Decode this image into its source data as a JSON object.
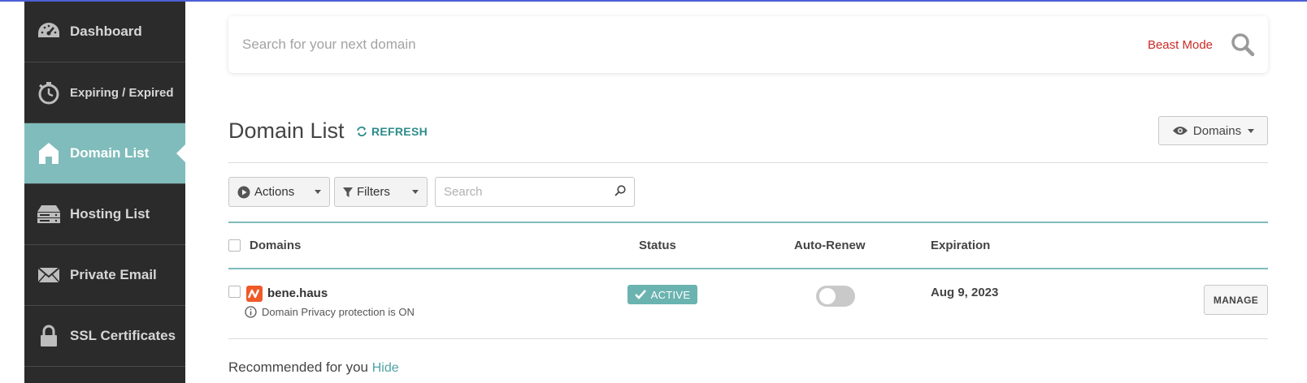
{
  "sidebar": {
    "items": [
      {
        "label": "Dashboard",
        "icon": "gauge-icon"
      },
      {
        "label": "Expiring / Expired",
        "icon": "stopwatch-icon"
      },
      {
        "label": "Domain List",
        "icon": "home-icon",
        "active": true
      },
      {
        "label": "Hosting List",
        "icon": "server-icon"
      },
      {
        "label": "Private Email",
        "icon": "envelope-icon"
      },
      {
        "label": "SSL Certificates",
        "icon": "lock-icon"
      }
    ]
  },
  "search": {
    "placeholder": "Search for your next domain",
    "beast_mode": "Beast Mode"
  },
  "header": {
    "title": "Domain List",
    "refresh": "REFRESH",
    "view_button": "Domains"
  },
  "toolbar": {
    "actions": "Actions",
    "filters": "Filters",
    "search_placeholder": "Search"
  },
  "table": {
    "columns": [
      "Domains",
      "Status",
      "Auto-Renew",
      "Expiration"
    ],
    "rows": [
      {
        "domain": "bene.haus",
        "note": "Domain Privacy protection is ON",
        "status": "ACTIVE",
        "auto_renew": false,
        "expiration": "Aug 9, 2023",
        "action": "MANAGE"
      }
    ]
  },
  "recommended": {
    "label": "Recommended for you",
    "hide": "Hide"
  },
  "colors": {
    "sidebar_bg": "#2b2b2b",
    "accent_teal": "#7fbcbb",
    "beast_red": "#cc2a25",
    "status_badge": "#6bb3b0",
    "logo_orange": "#f05a28"
  }
}
